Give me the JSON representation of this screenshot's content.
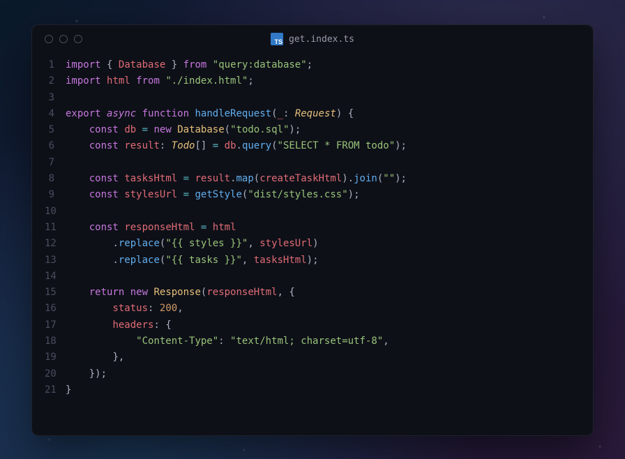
{
  "window": {
    "filename": "get.index.ts",
    "ts_badge": "TS"
  },
  "code": {
    "lines": [
      {
        "n": 1,
        "t": [
          [
            "kw",
            "import"
          ],
          [
            "def",
            " "
          ],
          [
            "pun",
            "{"
          ],
          [
            "def",
            " "
          ],
          [
            "var",
            "Database"
          ],
          [
            "def",
            " "
          ],
          [
            "pun",
            "}"
          ],
          [
            "def",
            " "
          ],
          [
            "kw",
            "from"
          ],
          [
            "def",
            " "
          ],
          [
            "str",
            "\"query:database\""
          ],
          [
            "pun",
            ";"
          ]
        ]
      },
      {
        "n": 2,
        "t": [
          [
            "kw",
            "import"
          ],
          [
            "def",
            " "
          ],
          [
            "var",
            "html"
          ],
          [
            "def",
            " "
          ],
          [
            "kw",
            "from"
          ],
          [
            "def",
            " "
          ],
          [
            "str",
            "\"./index.html\""
          ],
          [
            "pun",
            ";"
          ]
        ]
      },
      {
        "n": 3,
        "t": []
      },
      {
        "n": 4,
        "t": [
          [
            "kw",
            "export"
          ],
          [
            "def",
            " "
          ],
          [
            "kw2",
            "async"
          ],
          [
            "def",
            " "
          ],
          [
            "kw",
            "function"
          ],
          [
            "def",
            " "
          ],
          [
            "fn",
            "handleRequest"
          ],
          [
            "pun",
            "("
          ],
          [
            "var",
            "_"
          ],
          [
            "pun",
            ":"
          ],
          [
            "def",
            " "
          ],
          [
            "typ",
            "Request"
          ],
          [
            "pun",
            ")"
          ],
          [
            "def",
            " "
          ],
          [
            "pun",
            "{"
          ]
        ]
      },
      {
        "n": 5,
        "t": [
          [
            "def",
            "    "
          ],
          [
            "kw",
            "const"
          ],
          [
            "def",
            " "
          ],
          [
            "var",
            "db"
          ],
          [
            "def",
            " "
          ],
          [
            "op",
            "="
          ],
          [
            "def",
            " "
          ],
          [
            "kw",
            "new"
          ],
          [
            "def",
            " "
          ],
          [
            "cls",
            "Database"
          ],
          [
            "pun",
            "("
          ],
          [
            "str",
            "\"todo.sql\""
          ],
          [
            "pun",
            ");"
          ]
        ]
      },
      {
        "n": 6,
        "t": [
          [
            "def",
            "    "
          ],
          [
            "kw",
            "const"
          ],
          [
            "def",
            " "
          ],
          [
            "var",
            "result"
          ],
          [
            "pun",
            ":"
          ],
          [
            "def",
            " "
          ],
          [
            "typ",
            "Todo"
          ],
          [
            "pun",
            "[]"
          ],
          [
            "def",
            " "
          ],
          [
            "op",
            "="
          ],
          [
            "def",
            " "
          ],
          [
            "var",
            "db"
          ],
          [
            "pun",
            "."
          ],
          [
            "fn",
            "query"
          ],
          [
            "pun",
            "("
          ],
          [
            "str",
            "\"SELECT * FROM todo\""
          ],
          [
            "pun",
            ");"
          ]
        ]
      },
      {
        "n": 7,
        "t": []
      },
      {
        "n": 8,
        "t": [
          [
            "def",
            "    "
          ],
          [
            "kw",
            "const"
          ],
          [
            "def",
            " "
          ],
          [
            "var",
            "tasksHtml"
          ],
          [
            "def",
            " "
          ],
          [
            "op",
            "="
          ],
          [
            "def",
            " "
          ],
          [
            "var",
            "result"
          ],
          [
            "pun",
            "."
          ],
          [
            "fn",
            "map"
          ],
          [
            "pun",
            "("
          ],
          [
            "var",
            "createTaskHtml"
          ],
          [
            "pun",
            ")."
          ],
          [
            "fn",
            "join"
          ],
          [
            "pun",
            "("
          ],
          [
            "str",
            "\"\""
          ],
          [
            "pun",
            ");"
          ]
        ]
      },
      {
        "n": 9,
        "t": [
          [
            "def",
            "    "
          ],
          [
            "kw",
            "const"
          ],
          [
            "def",
            " "
          ],
          [
            "var",
            "stylesUrl"
          ],
          [
            "def",
            " "
          ],
          [
            "op",
            "="
          ],
          [
            "def",
            " "
          ],
          [
            "fn",
            "getStyle"
          ],
          [
            "pun",
            "("
          ],
          [
            "str",
            "\"dist/styles.css\""
          ],
          [
            "pun",
            ");"
          ]
        ]
      },
      {
        "n": 10,
        "t": []
      },
      {
        "n": 11,
        "t": [
          [
            "def",
            "    "
          ],
          [
            "kw",
            "const"
          ],
          [
            "def",
            " "
          ],
          [
            "var",
            "responseHtml"
          ],
          [
            "def",
            " "
          ],
          [
            "op",
            "="
          ],
          [
            "def",
            " "
          ],
          [
            "var",
            "html"
          ]
        ]
      },
      {
        "n": 12,
        "t": [
          [
            "def",
            "        "
          ],
          [
            "pun",
            "."
          ],
          [
            "fn",
            "replace"
          ],
          [
            "pun",
            "("
          ],
          [
            "str",
            "\"{{ styles }}\""
          ],
          [
            "pun",
            ","
          ],
          [
            "def",
            " "
          ],
          [
            "var",
            "stylesUrl"
          ],
          [
            "pun",
            ")"
          ]
        ]
      },
      {
        "n": 13,
        "t": [
          [
            "def",
            "        "
          ],
          [
            "pun",
            "."
          ],
          [
            "fn",
            "replace"
          ],
          [
            "pun",
            "("
          ],
          [
            "str",
            "\"{{ tasks }}\""
          ],
          [
            "pun",
            ","
          ],
          [
            "def",
            " "
          ],
          [
            "var",
            "tasksHtml"
          ],
          [
            "pun",
            ");"
          ]
        ]
      },
      {
        "n": 14,
        "t": []
      },
      {
        "n": 15,
        "t": [
          [
            "def",
            "    "
          ],
          [
            "kw",
            "return"
          ],
          [
            "def",
            " "
          ],
          [
            "kw",
            "new"
          ],
          [
            "def",
            " "
          ],
          [
            "cls",
            "Response"
          ],
          [
            "pun",
            "("
          ],
          [
            "var",
            "responseHtml"
          ],
          [
            "pun",
            ","
          ],
          [
            "def",
            " "
          ],
          [
            "pun",
            "{"
          ]
        ]
      },
      {
        "n": 16,
        "t": [
          [
            "def",
            "        "
          ],
          [
            "var",
            "status"
          ],
          [
            "pun",
            ":"
          ],
          [
            "def",
            " "
          ],
          [
            "num",
            "200"
          ],
          [
            "pun",
            ","
          ]
        ]
      },
      {
        "n": 17,
        "t": [
          [
            "def",
            "        "
          ],
          [
            "var",
            "headers"
          ],
          [
            "pun",
            ":"
          ],
          [
            "def",
            " "
          ],
          [
            "pun",
            "{"
          ]
        ]
      },
      {
        "n": 18,
        "t": [
          [
            "def",
            "            "
          ],
          [
            "str",
            "\"Content-Type\""
          ],
          [
            "pun",
            ":"
          ],
          [
            "def",
            " "
          ],
          [
            "str",
            "\"text/html; charset=utf-8\""
          ],
          [
            "pun",
            ","
          ]
        ]
      },
      {
        "n": 19,
        "t": [
          [
            "def",
            "        "
          ],
          [
            "pun",
            "},"
          ]
        ]
      },
      {
        "n": 20,
        "t": [
          [
            "def",
            "    "
          ],
          [
            "pun",
            "});"
          ]
        ]
      },
      {
        "n": 21,
        "t": [
          [
            "pun",
            "}"
          ]
        ]
      }
    ]
  }
}
